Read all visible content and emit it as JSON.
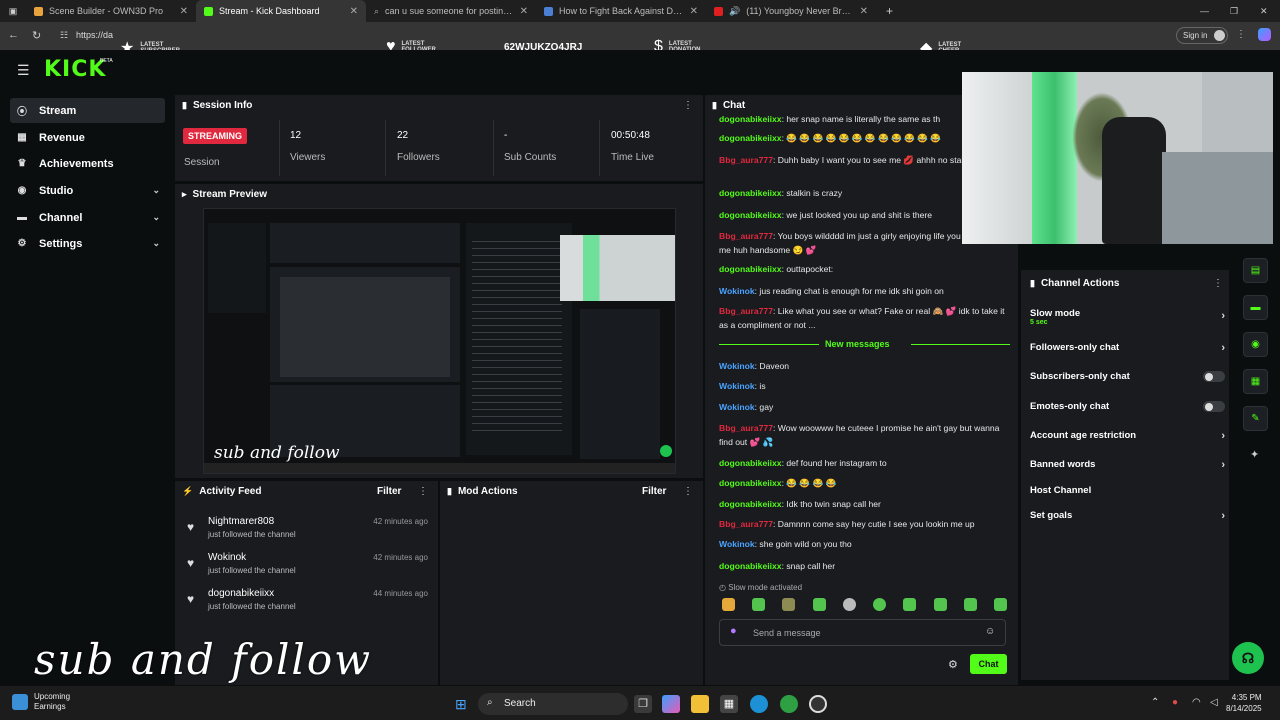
{
  "browser": {
    "tabs": [
      {
        "title": "Scene Builder - OWN3D Pro",
        "color": "#e8a33d"
      },
      {
        "title": "Stream - Kick Dashboard",
        "color": "#53fc18"
      },
      {
        "title": "can u sue someone for posting y...",
        "color": "#999999"
      },
      {
        "title": "How to Fight Back Against Defam...",
        "color": "#4a7fd4"
      },
      {
        "title": "(11) Youngboy Never Broke...",
        "color": "#e02020"
      }
    ],
    "url": "https://da",
    "new_tab": "+",
    "sign_in": "Sign in"
  },
  "overlay": {
    "latest_subscriber": "LATEST SUBSCRIBER",
    "latest_follower": "LATEST FOLLOWER",
    "code": "62WJUKZQ4JRJ",
    "latest_donation": "LATEST DONATION",
    "latest_cheer": "LATEST CHEER"
  },
  "brand": {
    "logo": "KICK",
    "beta": "BETA"
  },
  "nav": [
    {
      "label": "Stream",
      "icon": "((·))"
    },
    {
      "label": "Revenue",
      "icon": "▦"
    },
    {
      "label": "Achievements",
      "icon": "♛"
    },
    {
      "label": "Studio",
      "icon": "◉"
    },
    {
      "label": "Channel",
      "icon": "▬"
    },
    {
      "label": "Settings",
      "icon": "⚙"
    }
  ],
  "session": {
    "title": "Session Info",
    "status": "STREAMING",
    "status_label": "Session",
    "viewers": "12",
    "viewers_label": "Viewers",
    "followers": "22",
    "followers_label": "Followers",
    "sub_counts": "-",
    "sub_counts_label": "Sub Counts",
    "time_live": "00:50:48",
    "time_live_label": "Time Live"
  },
  "preview": {
    "title": "Stream Preview",
    "overlay_text": "sub and follow"
  },
  "activity": {
    "title": "Activity Feed",
    "filter": "Filter",
    "items": [
      {
        "name": "Nightmarer808",
        "action": "just followed the channel",
        "time": "42 minutes ago"
      },
      {
        "name": "Wokinok",
        "action": "just followed the channel",
        "time": "42 minutes ago"
      },
      {
        "name": "dogonabikeiixx",
        "action": "just followed the channel",
        "time": "44 minutes ago"
      }
    ]
  },
  "mod_actions": {
    "title": "Mod Actions",
    "filter": "Filter"
  },
  "chat": {
    "title": "Chat",
    "messages": [
      {
        "user": "dogonabikeiixx",
        "color": "#53fc18",
        "text": ": her snap name is literally the same as th"
      },
      {
        "user": "dogonabikeiixx",
        "color": "#53fc18",
        "text": ": 😂 😂 😂 😂 😂 😂 😂 😂 😂 😂 😂 😂"
      },
      {
        "user": "Bbg_aura777",
        "color": "#e0283e",
        "text": ": Duhh baby I want you to see me 💋 ahhh no stalking me stfu"
      },
      {
        "user": "dogonabikeiixx",
        "color": "#53fc18",
        "text": ": stalkin is crazy"
      },
      {
        "user": "dogonabikeiixx",
        "color": "#53fc18",
        "text": ": we just looked you up and shit is there"
      },
      {
        "user": "Bbg_aura777",
        "color": "#e0283e",
        "text": ": You boys wildddd im just a girly enjoying life you were with me huh handsome 😏 💕"
      },
      {
        "user": "dogonabikeiixx",
        "color": "#53fc18",
        "text": ": outtapocket:"
      },
      {
        "user": "Wokinok",
        "color": "#4aa3ff",
        "text": ": jus reading chat is enough for me idk shi goin on"
      },
      {
        "user": "Bbg_aura777",
        "color": "#e0283e",
        "text": ": Like what you see or what? Fake or real 🙈 💕 idk to take it as a compliment or not ..."
      },
      {
        "user": "Wokinok",
        "color": "#4aa3ff",
        "text": ": Daveon"
      },
      {
        "user": "Wokinok",
        "color": "#4aa3ff",
        "text": ": is"
      },
      {
        "user": "Wokinok",
        "color": "#4aa3ff",
        "text": ": gay"
      },
      {
        "user": "Bbg_aura777",
        "color": "#e0283e",
        "text": ": Wow woowww he cuteee I promise he ain't gay but wanna find out 💕 💦"
      },
      {
        "user": "dogonabikeiixx",
        "color": "#53fc18",
        "text": ": def found her instagram to"
      },
      {
        "user": "dogonabikeiixx",
        "color": "#53fc18",
        "text": ": 😂 😂 😂 😂"
      },
      {
        "user": "dogonabikeiixx",
        "color": "#53fc18",
        "text": ": Idk tho twin snap call her"
      },
      {
        "user": "Bbg_aura777",
        "color": "#e0283e",
        "text": ": Damnnn come say hey cutie I see you lookin me up"
      },
      {
        "user": "Wokinok",
        "color": "#4aa3ff",
        "text": ": she goin wild on you tho"
      },
      {
        "user": "dogonabikeiixx",
        "color": "#53fc18",
        "text": ": snap call her"
      }
    ],
    "new_messages": "New messages",
    "slow_mode_note": "Slow mode activated",
    "input_placeholder": "Send a message",
    "send_label": "Chat"
  },
  "channel_actions": {
    "title": "Channel Actions",
    "items": [
      {
        "label": "Slow mode",
        "sub": "5 sec",
        "control": "chevron"
      },
      {
        "label": "Followers-only chat",
        "control": "chevron"
      },
      {
        "label": "Subscribers-only chat",
        "control": "toggle"
      },
      {
        "label": "Emotes-only chat",
        "control": "toggle"
      },
      {
        "label": "Account age restriction",
        "control": "chevron"
      },
      {
        "label": "Banned words",
        "control": "chevron"
      },
      {
        "label": "Host Channel",
        "control": "none"
      },
      {
        "label": "Set goals",
        "control": "chevron"
      }
    ]
  },
  "watermark": "sub and follow",
  "taskbar": {
    "weather_line1": "Upcoming",
    "weather_line2": "Earnings",
    "search": "Search",
    "time": "4:35 PM",
    "date": "8/14/2025"
  },
  "colors": {
    "accent": "#53fc18",
    "live": "#e0283e",
    "panel": "#191b1f"
  }
}
